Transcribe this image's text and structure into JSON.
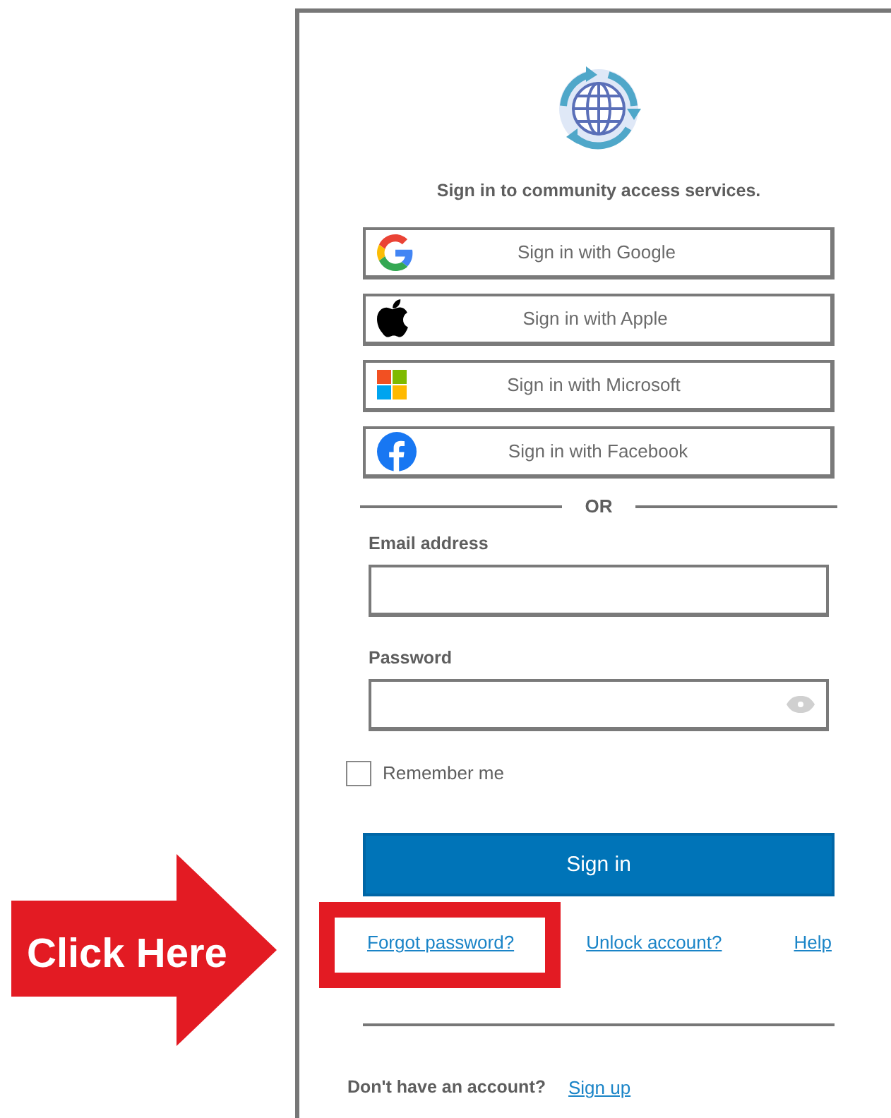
{
  "title": "Sign in to community access services.",
  "social_buttons": [
    {
      "kind": "google",
      "label": "Sign in with Google"
    },
    {
      "kind": "apple",
      "label": "Sign in with Apple"
    },
    {
      "kind": "microsoft",
      "label": "Sign in with Microsoft"
    },
    {
      "kind": "facebook",
      "label": "Sign in with Facebook"
    }
  ],
  "divider_text": "OR",
  "fields": [
    {
      "kind": "text",
      "label": "Email address"
    },
    {
      "kind": "password",
      "label": "Password"
    }
  ],
  "remember": {
    "label": "Remember me",
    "checked": false
  },
  "submit": "Sign in",
  "links": [
    {
      "label": "Forgot password?",
      "highlighted": true
    },
    {
      "label": "Unlock account?",
      "highlighted": false
    },
    {
      "label": "Help",
      "highlighted": false
    }
  ],
  "signup": {
    "prompt": "Don't have an account?",
    "link": "Sign up"
  },
  "callout": {
    "label": "Click Here"
  }
}
